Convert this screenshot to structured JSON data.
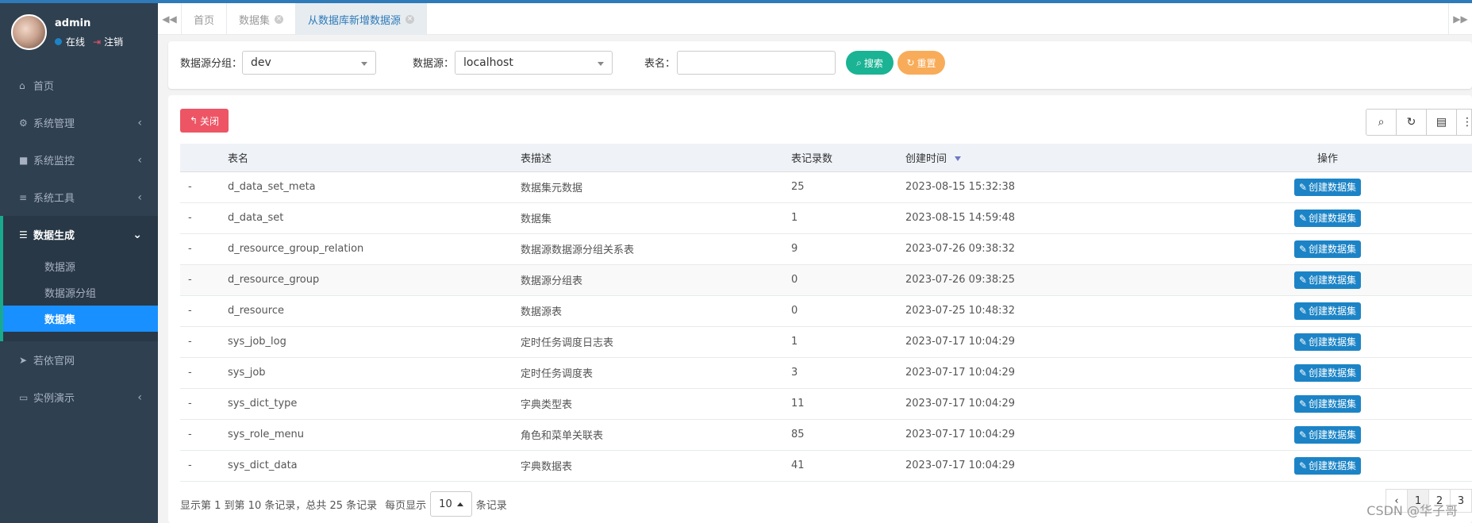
{
  "user": {
    "name": "admin",
    "status": "在线",
    "logout": "注销"
  },
  "sidebar": {
    "items": [
      {
        "label": "首页",
        "icon": "home-icon"
      },
      {
        "label": "系统管理",
        "icon": "gear-icon"
      },
      {
        "label": "系统监控",
        "icon": "video-icon"
      },
      {
        "label": "系统工具",
        "icon": "bars-icon"
      },
      {
        "label": "数据生成",
        "icon": "database-icon"
      },
      {
        "label": "若依官网",
        "icon": "paper-plane-icon"
      },
      {
        "label": "实例演示",
        "icon": "desktop-icon"
      }
    ],
    "subitems": [
      "数据源",
      "数据源分组",
      "数据集"
    ]
  },
  "tabs": [
    "首页",
    "数据集",
    "从数据库新增数据源"
  ],
  "search": {
    "group_label": "数据源分组：",
    "group_value": "dev",
    "source_label": "数据源：",
    "source_value": "localhost",
    "table_label": "表名：",
    "table_value": "",
    "search_btn": "搜索",
    "reset_btn": "重置"
  },
  "toolbar": {
    "close_btn": "关闭"
  },
  "table": {
    "headers": [
      "表名",
      "表描述",
      "表记录数",
      "创建时间",
      "操作"
    ],
    "action_label": "创建数据集",
    "rows": [
      {
        "idx": "-",
        "name": "d_data_set_meta",
        "desc": "数据集元数据",
        "count": "25",
        "time": "2023-08-15 15:32:38"
      },
      {
        "idx": "-",
        "name": "d_data_set",
        "desc": "数据集",
        "count": "1",
        "time": "2023-08-15 14:59:48"
      },
      {
        "idx": "-",
        "name": "d_resource_group_relation",
        "desc": "数据源数据源分组关系表",
        "count": "9",
        "time": "2023-07-26 09:38:32"
      },
      {
        "idx": "-",
        "name": "d_resource_group",
        "desc": "数据源分组表",
        "count": "0",
        "time": "2023-07-26 09:38:25"
      },
      {
        "idx": "-",
        "name": "d_resource",
        "desc": "数据源表",
        "count": "0",
        "time": "2023-07-25 10:48:32"
      },
      {
        "idx": "-",
        "name": "sys_job_log",
        "desc": "定时任务调度日志表",
        "count": "1",
        "time": "2023-07-17 10:04:29"
      },
      {
        "idx": "-",
        "name": "sys_job",
        "desc": "定时任务调度表",
        "count": "3",
        "time": "2023-07-17 10:04:29"
      },
      {
        "idx": "-",
        "name": "sys_dict_type",
        "desc": "字典类型表",
        "count": "11",
        "time": "2023-07-17 10:04:29"
      },
      {
        "idx": "-",
        "name": "sys_role_menu",
        "desc": "角色和菜单关联表",
        "count": "85",
        "time": "2023-07-17 10:04:29"
      },
      {
        "idx": "-",
        "name": "sys_dict_data",
        "desc": "字典数据表",
        "count": "41",
        "time": "2023-07-17 10:04:29"
      }
    ]
  },
  "pagination": {
    "info": "显示第 1 到第 10 条记录，总共 25 条记录",
    "per_page_prefix": "每页显示",
    "per_page_value": "10",
    "per_page_suffix": "条记录",
    "pages": [
      "‹",
      "1",
      "2",
      "3"
    ]
  },
  "watermark": "CSDN @华子哥",
  "colors": {
    "sidebar_bg": "#2f4050",
    "active_sub": "#1890ff",
    "accent_green": "#1ab394",
    "danger": "#ed5565",
    "warning": "#f8ac59",
    "primary": "#1c84c6"
  }
}
